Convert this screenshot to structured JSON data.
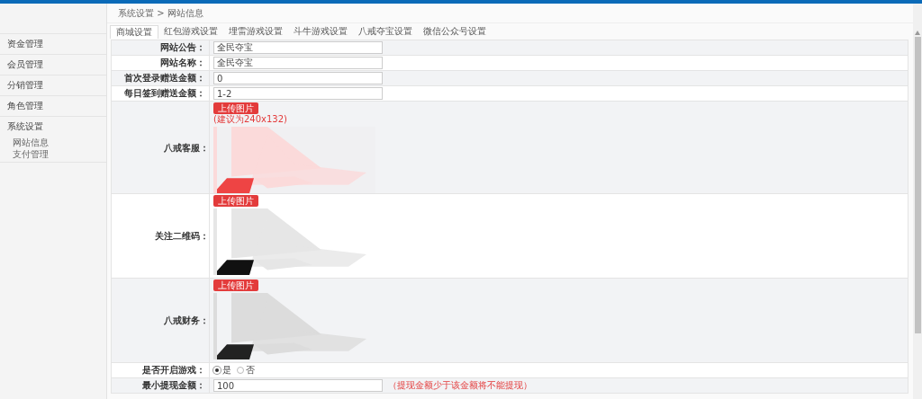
{
  "sidebar": {
    "items": [
      {
        "label": "资金管理"
      },
      {
        "label": "会员管理"
      },
      {
        "label": "分销管理"
      },
      {
        "label": "角色管理"
      },
      {
        "label": "系统设置",
        "children": [
          {
            "label": "网站信息"
          },
          {
            "label": "支付管理"
          }
        ]
      }
    ]
  },
  "breadcrumb": "系统设置 > 网站信息",
  "tabs": [
    {
      "label": "商城设置",
      "selected": true
    },
    {
      "label": "红包游戏设置",
      "selected": false
    },
    {
      "label": "埋雷游戏设置",
      "selected": false
    },
    {
      "label": "斗牛游戏设置",
      "selected": false
    },
    {
      "label": "八戒夺宝设置",
      "selected": false
    },
    {
      "label": "微信公众号设置",
      "selected": false
    }
  ],
  "form": [
    {
      "kind": "text",
      "label": "网站公告：",
      "value": "全民夺宝"
    },
    {
      "kind": "text",
      "label": "网站名称：",
      "value": "全民夺宝"
    },
    {
      "kind": "text",
      "label": "首次登录赠送金额：",
      "value": "0"
    },
    {
      "kind": "text",
      "label": "每日签到赠送金额：",
      "value": "1-2"
    },
    {
      "label": "八戒客服：",
      "button": "上传图片",
      "hint": "(建议为240x132)"
    },
    {
      "label": "关注二维码：",
      "button": "上传图片"
    },
    {
      "label": "八戒财务：",
      "button": "上传图片"
    },
    {
      "kind": "radio",
      "label": "是否开启游戏：",
      "options": [
        {
          "label": "是",
          "selected": true
        },
        {
          "label": "否",
          "selected": false
        }
      ]
    },
    {
      "kind": "text",
      "label": "最小提现金额：",
      "value": "100",
      "note": "（提现金额少于该金额将不能提现）"
    }
  ]
}
